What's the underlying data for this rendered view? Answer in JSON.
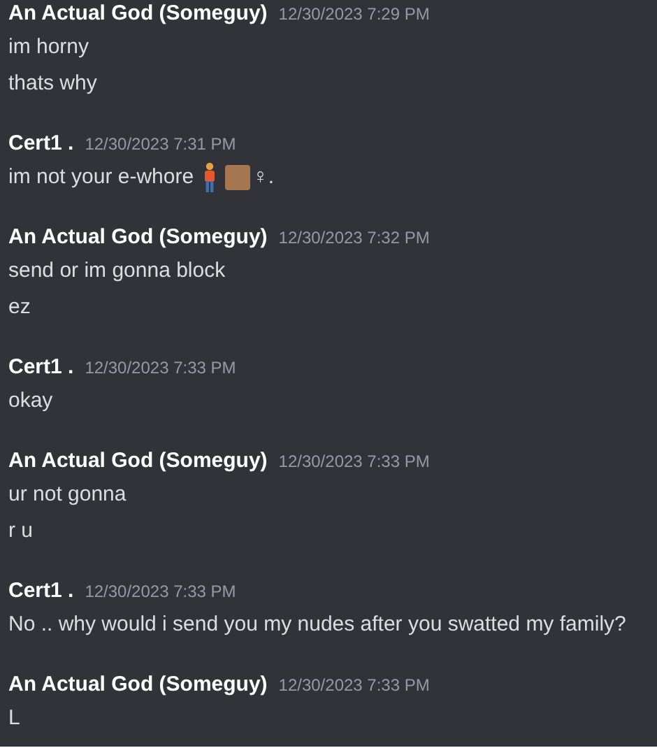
{
  "messages": [
    {
      "author": "An Actual God (Someguy)",
      "time": "12/30/2023 7:29 PM",
      "lines": [
        {
          "text": "im horny"
        },
        {
          "text": "thats why"
        }
      ]
    },
    {
      "author": "Cert1 .",
      "time": "12/30/2023 7:31 PM",
      "lines": [
        {
          "text": "im not your e-whore",
          "emoji": true,
          "suffix": "♀."
        }
      ]
    },
    {
      "author": "An Actual God (Someguy)",
      "time": "12/30/2023 7:32 PM",
      "lines": [
        {
          "text": "send or im gonna block"
        },
        {
          "text": "ez"
        }
      ]
    },
    {
      "author": "Cert1 .",
      "time": "12/30/2023 7:33 PM",
      "lines": [
        {
          "text": "okay"
        }
      ]
    },
    {
      "author": "An Actual God (Someguy)",
      "time": "12/30/2023 7:33 PM",
      "lines": [
        {
          "text": "ur not gonna"
        },
        {
          "text": "r u"
        }
      ]
    },
    {
      "author": "Cert1 .",
      "time": "12/30/2023 7:33 PM",
      "lines": [
        {
          "text": "No .. why would i send you my nudes after you swatted my family?"
        }
      ]
    },
    {
      "author": "An Actual God (Someguy)",
      "time": "12/30/2023 7:33 PM",
      "lines": [
        {
          "text": "L"
        }
      ]
    }
  ]
}
